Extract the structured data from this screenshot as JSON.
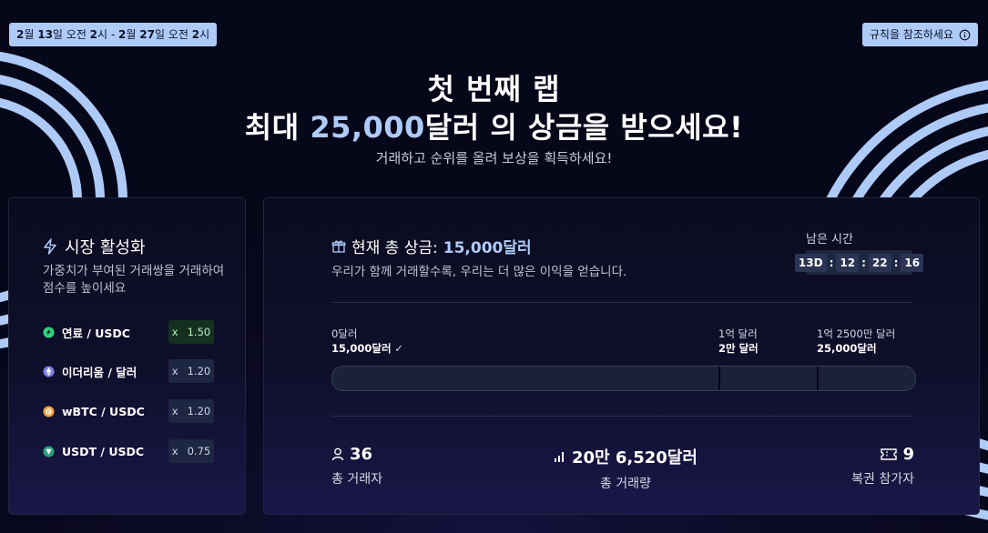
{
  "header": {
    "date_range": {
      "start_month": "2",
      "month_unit_1": "월 ",
      "start_day": "13",
      "start_suffix": "일 오전 ",
      "start_hour": "2",
      "hour_unit_1": "시 - ",
      "end_month": "2",
      "month_unit_2": "월 ",
      "end_day": "27",
      "end_suffix": "일 오전 ",
      "end_hour": "2",
      "hour_unit_2": "시"
    },
    "rules_label": "규칙을 참조하세요"
  },
  "hero": {
    "title": "첫 번째 랩",
    "prize_prefix": "최대 ",
    "prize_amount": "25,000",
    "prize_suffix": "달러 의 상금을 받으세요!",
    "subtitle": "거래하고 순위를 올려 보상을 획득하세요!"
  },
  "market": {
    "title": "시장 활성화",
    "description": "가중치가 부여된 거래쌍을 거래하여 점수를 높이세요",
    "pairs": [
      {
        "name": "연료 / USDC",
        "x": "x",
        "multiplier": "1.50",
        "icon": "fuel-coin-icon",
        "color": "#35d07f",
        "highlight": true
      },
      {
        "name": "이더리움 / 달러",
        "x": "x",
        "multiplier": "1.20",
        "icon": "ethereum-icon",
        "color": "#7b7fe8",
        "highlight": false
      },
      {
        "name": "wBTC / USDC",
        "x": "x",
        "multiplier": "1.20",
        "icon": "bitcoin-icon",
        "color": "#f0a33a",
        "highlight": false
      },
      {
        "name": "USDT / USDC",
        "x": "x",
        "multiplier": "0.75",
        "icon": "tether-icon",
        "color": "#26a17b",
        "highlight": false
      }
    ]
  },
  "prize_pool": {
    "label": "현재 총 상금:",
    "amount": "15,000달러",
    "description": "우리가 함께 거래할수록, 우리는 더 많은 이익을 얻습니다.",
    "remaining_label": "남은 시간",
    "timer": {
      "days": "13D",
      "hours": "12",
      "minutes": "22",
      "seconds": "16",
      "sep": ":"
    },
    "milestones": [
      {
        "volume": "0달러",
        "prize": "15,000달러",
        "check": "✓"
      },
      {
        "volume": "1억 달러",
        "prize": "2만 달러"
      },
      {
        "volume": "1억 2500만 달러",
        "prize": "25,000달러"
      }
    ],
    "progress": 0.0
  },
  "stats": [
    {
      "value": "36",
      "label": "총 거래자",
      "icon": "user-icon"
    },
    {
      "value": "20만 6,520달러",
      "label": "총 거래량",
      "icon": "bar-chart-icon"
    },
    {
      "value": "9",
      "label": "복권 참가자",
      "icon": "ticket-icon"
    }
  ],
  "colors": {
    "accent": "#aecbf8",
    "background": "#07071a"
  }
}
